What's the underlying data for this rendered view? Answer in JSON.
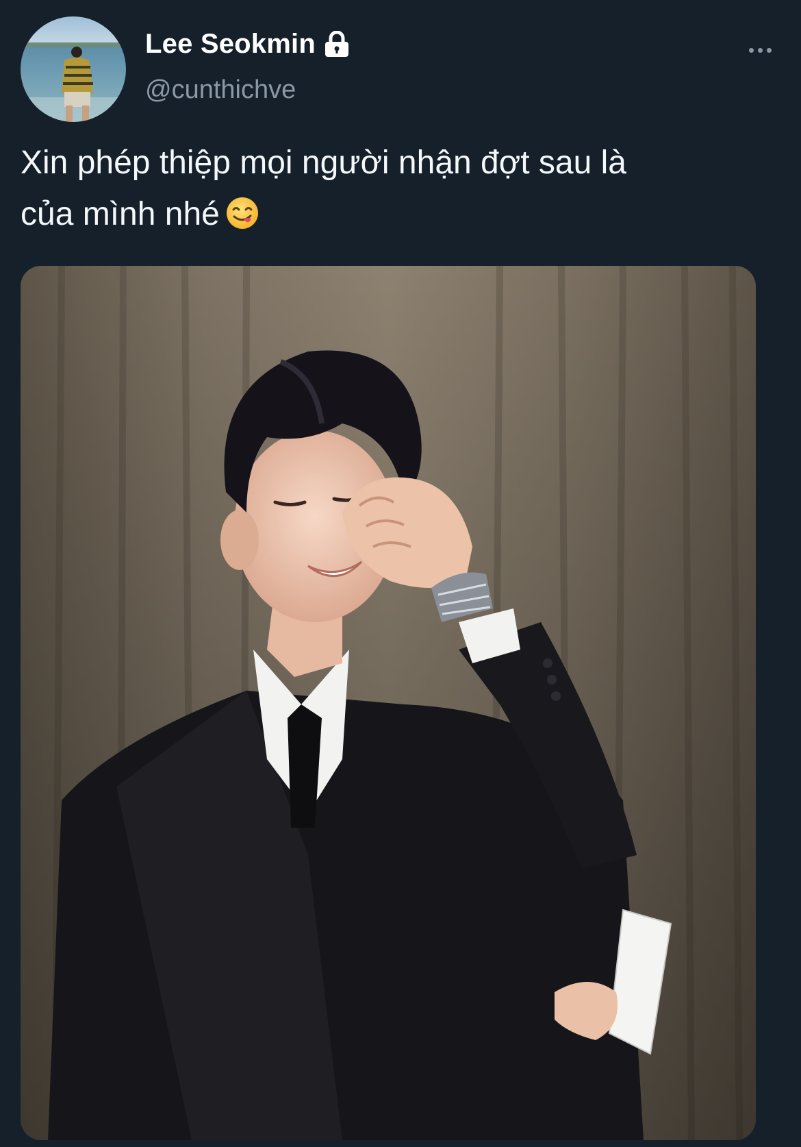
{
  "tweet": {
    "author": {
      "display_name": "Lee Seokmin",
      "handle": "@cunthichve",
      "protected_icon": "lock-icon",
      "avatar_icon": "avatar-photo"
    },
    "menu_icon": "more-options-icon",
    "text_lines": [
      "Xin phép thiệp mọi người nhận đợt sau là",
      "của mình nhé"
    ],
    "emoji": "yum-face-emoji",
    "media": {
      "kind": "photo"
    }
  },
  "colors": {
    "background": "#15202b",
    "primary_text": "#ffffff",
    "secondary_text": "#8b98a5"
  }
}
